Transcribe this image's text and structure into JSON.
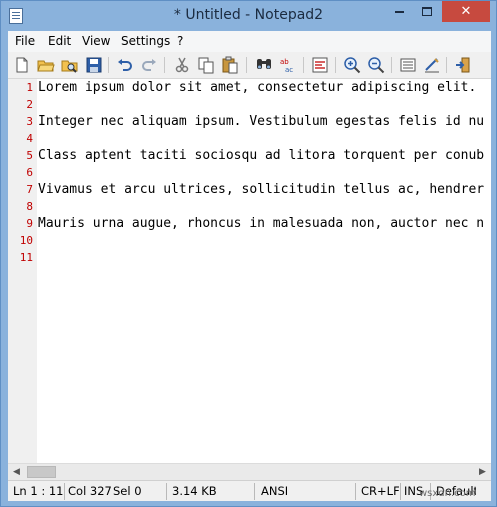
{
  "window": {
    "title": "* Untitled - Notepad2"
  },
  "title_buttons": {
    "close": "✕"
  },
  "menu": [
    {
      "label": "File"
    },
    {
      "label": "Edit"
    },
    {
      "label": "View"
    },
    {
      "label": "Settings"
    },
    {
      "label": "?"
    }
  ],
  "toolbar": [
    {
      "icon": "new-document-icon"
    },
    {
      "icon": "open-folder-icon"
    },
    {
      "icon": "browse-icon"
    },
    {
      "icon": "save-icon"
    },
    {
      "icon": "undo-icon"
    },
    {
      "icon": "redo-icon"
    },
    {
      "icon": "cut-icon"
    },
    {
      "icon": "copy-icon"
    },
    {
      "icon": "paste-icon"
    },
    {
      "icon": "find-icon"
    },
    {
      "icon": "replace-icon"
    },
    {
      "icon": "word-wrap-icon"
    },
    {
      "icon": "zoom-in-icon"
    },
    {
      "icon": "zoom-out-icon"
    },
    {
      "icon": "scheme-icon"
    },
    {
      "icon": "customize-icon"
    },
    {
      "icon": "exit-icon"
    }
  ],
  "editor": {
    "lines": [
      {
        "number": "1",
        "text": "Lorem ipsum dolor sit amet, consectetur adipiscing elit."
      },
      {
        "number": "2",
        "text": ""
      },
      {
        "number": "3",
        "text": "Integer nec aliquam ipsum. Vestibulum egestas felis id nu"
      },
      {
        "number": "4",
        "text": ""
      },
      {
        "number": "5",
        "text": "Class aptent taciti sociosqu ad litora torquent per conub"
      },
      {
        "number": "6",
        "text": ""
      },
      {
        "number": "7",
        "text": "Vivamus et arcu ultrices, sollicitudin tellus ac, hendrer"
      },
      {
        "number": "8",
        "text": ""
      },
      {
        "number": "9",
        "text": "Mauris urna augue, rhoncus in malesuada non, auctor nec n"
      },
      {
        "number": "10",
        "text": ""
      },
      {
        "number": "11",
        "text": ""
      }
    ]
  },
  "scrollbar": {
    "left_arrow": "◀",
    "right_arrow": "▶"
  },
  "status": {
    "position": "Ln 1 : 11",
    "column": "Col 327",
    "selection": "Sel 0",
    "size": "3.14 KB",
    "encoding": "ANSI",
    "line_endings": "CR+LF",
    "mode": "INS",
    "scheme": "Default"
  },
  "watermark": "wsxdn.com"
}
